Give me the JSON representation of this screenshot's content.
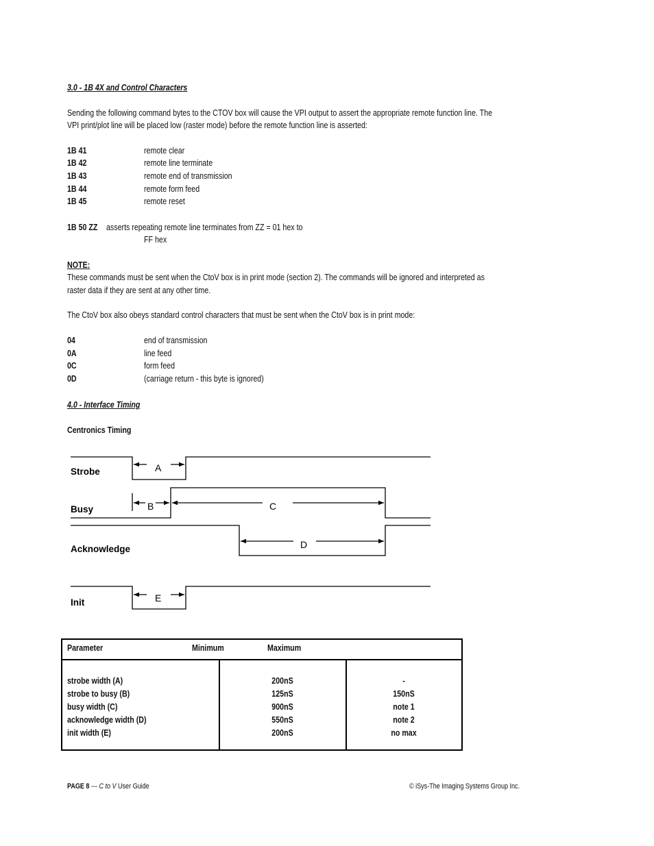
{
  "section3": {
    "heading": "3.0 - 1B 4X and Control Characters",
    "intro_lines": [
      "Sending the following command bytes to the CTOV box will cause the VPI output to assert the appropriate remote function line. The",
      "VPI print/plot line will be placed low (raster mode) before the remote function line is asserted:"
    ],
    "commands": [
      {
        "code": "1B 41",
        "desc": "remote clear"
      },
      {
        "code": "1B 42",
        "desc": "remote line terminate"
      },
      {
        "code": "1B 43",
        "desc": "remote end of transmission"
      },
      {
        "code": "1B 44",
        "desc": "remote form feed"
      },
      {
        "code": "1B 45",
        "desc": "remote reset"
      }
    ],
    "repeat_command": {
      "code": "1B 50 ZZ",
      "desc_line1": "asserts repeating remote line terminates from ZZ = 01 hex to",
      "desc_line2": "FF hex"
    },
    "note_label": "NOTE:",
    "note_lines": [
      "These commands must be sent when the CtoV box is in print mode (section 2). The commands will be ignored and interpreted as",
      "raster data if they are sent at any other time."
    ],
    "control_intro": "The CtoV box also obeys standard control characters that must be sent when the CtoV box is in print mode:",
    "control_chars": [
      {
        "code": "04",
        "desc": "end of transmission"
      },
      {
        "code": "0A",
        "desc": "line feed"
      },
      {
        "code": "0C",
        "desc": "form feed"
      },
      {
        "code": "0D",
        "desc": "(carriage return - this byte is ignored)"
      }
    ]
  },
  "section4": {
    "heading": "4.0 - Interface Timing",
    "subheading": "Centronics Timing",
    "diagram": {
      "signals": [
        "Strobe",
        "Busy",
        "Acknowledge",
        "Init"
      ],
      "intervals": [
        "A",
        "B",
        "C",
        "D",
        "E"
      ]
    },
    "table": {
      "headers": [
        "Parameter",
        "Minimum",
        "Maximum"
      ],
      "rows": [
        {
          "parameter": "strobe width (A)",
          "minimum": "200nS",
          "maximum": "-"
        },
        {
          "parameter": "strobe to busy (B)",
          "minimum": "125nS",
          "maximum": "150nS"
        },
        {
          "parameter": "busy width (C)",
          "minimum": "900nS",
          "maximum": "note 1"
        },
        {
          "parameter": "acknowledge width (D)",
          "minimum": "550nS",
          "maximum": "note 2"
        },
        {
          "parameter": "init width (E)",
          "minimum": "200nS",
          "maximum": "no max"
        }
      ]
    }
  },
  "footer": {
    "page_label": "PAGE 8",
    "separator": " --- ",
    "product": "C to V",
    "guide": " User Guide",
    "copyright": "© iSys-The Imaging Systems Group Inc."
  }
}
